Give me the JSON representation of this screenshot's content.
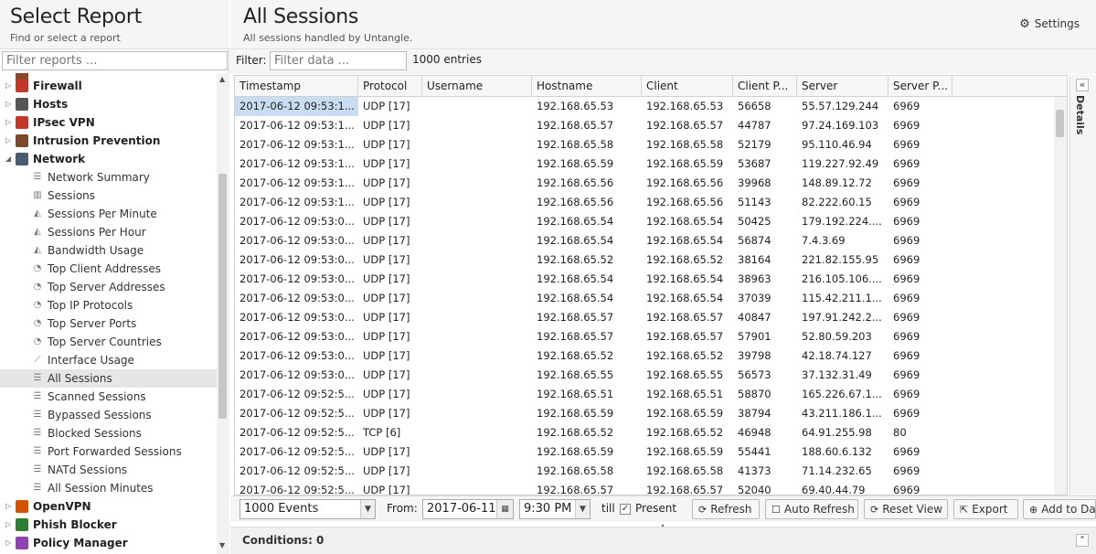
{
  "left": {
    "title": "Select Report",
    "subtitle": "Find or select a report",
    "filter_placeholder": "Filter reports ..."
  },
  "tree": [
    {
      "kind": "cat",
      "label": "Firewall",
      "color": "#c0392b",
      "expanded": false
    },
    {
      "kind": "cat",
      "label": "Hosts",
      "color": "#555555",
      "expanded": false
    },
    {
      "kind": "cat",
      "label": "IPsec VPN",
      "color": "#c0392b",
      "expanded": false
    },
    {
      "kind": "cat",
      "label": "Intrusion Prevention",
      "color": "#7a4a2a",
      "expanded": false
    },
    {
      "kind": "cat",
      "label": "Network",
      "color": "#4a5a70",
      "expanded": true
    },
    {
      "kind": "leaf",
      "label": "Network Summary",
      "icon": "list"
    },
    {
      "kind": "leaf",
      "label": "Sessions",
      "icon": "bar"
    },
    {
      "kind": "leaf",
      "label": "Sessions Per Minute",
      "icon": "area"
    },
    {
      "kind": "leaf",
      "label": "Sessions Per Hour",
      "icon": "area"
    },
    {
      "kind": "leaf",
      "label": "Bandwidth Usage",
      "icon": "area"
    },
    {
      "kind": "leaf",
      "label": "Top Client Addresses",
      "icon": "pie"
    },
    {
      "kind": "leaf",
      "label": "Top Server Addresses",
      "icon": "pie"
    },
    {
      "kind": "leaf",
      "label": "Top IP Protocols",
      "icon": "pie"
    },
    {
      "kind": "leaf",
      "label": "Top Server Ports",
      "icon": "pie"
    },
    {
      "kind": "leaf",
      "label": "Top Server Countries",
      "icon": "pie"
    },
    {
      "kind": "leaf",
      "label": "Interface Usage",
      "icon": "line"
    },
    {
      "kind": "leaf",
      "label": "All Sessions",
      "icon": "list",
      "selected": true
    },
    {
      "kind": "leaf",
      "label": "Scanned Sessions",
      "icon": "list"
    },
    {
      "kind": "leaf",
      "label": "Bypassed Sessions",
      "icon": "list"
    },
    {
      "kind": "leaf",
      "label": "Blocked Sessions",
      "icon": "list"
    },
    {
      "kind": "leaf",
      "label": "Port Forwarded Sessions",
      "icon": "list"
    },
    {
      "kind": "leaf",
      "label": "NATd Sessions",
      "icon": "list"
    },
    {
      "kind": "leaf",
      "label": "All Session Minutes",
      "icon": "list"
    },
    {
      "kind": "cat",
      "label": "OpenVPN",
      "color": "#d35400",
      "expanded": false
    },
    {
      "kind": "cat",
      "label": "Phish Blocker",
      "color": "#2e7d32",
      "expanded": false
    },
    {
      "kind": "cat",
      "label": "Policy Manager",
      "color": "#8e44ad",
      "expanded": false
    }
  ],
  "main": {
    "title": "All Sessions",
    "subtitle": "All sessions handled by Untangle.",
    "settings_label": "Settings",
    "filter_label": "Filter:",
    "filter_placeholder": "Filter data ...",
    "entries": "1000 entries",
    "details_label": "Details"
  },
  "columns": [
    "Timestamp",
    "Protocol",
    "Username",
    "Hostname",
    "Client",
    "Client P...",
    "Server",
    "Server P..."
  ],
  "rows": [
    [
      "2017-06-12 09:53:1...",
      "UDP [17]",
      "",
      "192.168.65.53",
      "192.168.65.53",
      "56658",
      "55.57.129.244",
      "6969"
    ],
    [
      "2017-06-12 09:53:1...",
      "UDP [17]",
      "",
      "192.168.65.57",
      "192.168.65.57",
      "44787",
      "97.24.169.103",
      "6969"
    ],
    [
      "2017-06-12 09:53:1...",
      "UDP [17]",
      "",
      "192.168.65.58",
      "192.168.65.58",
      "52179",
      "95.110.46.94",
      "6969"
    ],
    [
      "2017-06-12 09:53:1...",
      "UDP [17]",
      "",
      "192.168.65.59",
      "192.168.65.59",
      "53687",
      "119.227.92.49",
      "6969"
    ],
    [
      "2017-06-12 09:53:1...",
      "UDP [17]",
      "",
      "192.168.65.56",
      "192.168.65.56",
      "39968",
      "148.89.12.72",
      "6969"
    ],
    [
      "2017-06-12 09:53:1...",
      "UDP [17]",
      "",
      "192.168.65.56",
      "192.168.65.56",
      "51143",
      "82.222.60.15",
      "6969"
    ],
    [
      "2017-06-12 09:53:0...",
      "UDP [17]",
      "",
      "192.168.65.54",
      "192.168.65.54",
      "50425",
      "179.192.224....",
      "6969"
    ],
    [
      "2017-06-12 09:53:0...",
      "UDP [17]",
      "",
      "192.168.65.54",
      "192.168.65.54",
      "56874",
      "7.4.3.69",
      "6969"
    ],
    [
      "2017-06-12 09:53:0...",
      "UDP [17]",
      "",
      "192.168.65.52",
      "192.168.65.52",
      "38164",
      "221.82.155.95",
      "6969"
    ],
    [
      "2017-06-12 09:53:0...",
      "UDP [17]",
      "",
      "192.168.65.54",
      "192.168.65.54",
      "38963",
      "216.105.106....",
      "6969"
    ],
    [
      "2017-06-12 09:53:0...",
      "UDP [17]",
      "",
      "192.168.65.54",
      "192.168.65.54",
      "37039",
      "115.42.211.1...",
      "6969"
    ],
    [
      "2017-06-12 09:53:0...",
      "UDP [17]",
      "",
      "192.168.65.57",
      "192.168.65.57",
      "40847",
      "197.91.242.2...",
      "6969"
    ],
    [
      "2017-06-12 09:53:0...",
      "UDP [17]",
      "",
      "192.168.65.57",
      "192.168.65.57",
      "57901",
      "52.80.59.203",
      "6969"
    ],
    [
      "2017-06-12 09:53:0...",
      "UDP [17]",
      "",
      "192.168.65.52",
      "192.168.65.52",
      "39798",
      "42.18.74.127",
      "6969"
    ],
    [
      "2017-06-12 09:53:0...",
      "UDP [17]",
      "",
      "192.168.65.55",
      "192.168.65.55",
      "56573",
      "37.132.31.49",
      "6969"
    ],
    [
      "2017-06-12 09:52:5...",
      "UDP [17]",
      "",
      "192.168.65.51",
      "192.168.65.51",
      "58870",
      "165.226.67.1...",
      "6969"
    ],
    [
      "2017-06-12 09:52:5...",
      "UDP [17]",
      "",
      "192.168.65.59",
      "192.168.65.59",
      "38794",
      "43.211.186.1...",
      "6969"
    ],
    [
      "2017-06-12 09:52:5...",
      "TCP [6]",
      "",
      "192.168.65.52",
      "192.168.65.52",
      "46948",
      "64.91.255.98",
      "80"
    ],
    [
      "2017-06-12 09:52:5...",
      "UDP [17]",
      "",
      "192.168.65.59",
      "192.168.65.59",
      "55441",
      "188.60.6.132",
      "6969"
    ],
    [
      "2017-06-12 09:52:5...",
      "UDP [17]",
      "",
      "192.168.65.58",
      "192.168.65.58",
      "41373",
      "71.14.232.65",
      "6969"
    ],
    [
      "2017-06-12 09:52:5...",
      "UDP [17]",
      "",
      "192.168.65.57",
      "192.168.65.57",
      "52040",
      "69.40.44.79",
      "6969"
    ]
  ],
  "toolbar": {
    "events_value": "1000 Events",
    "from_label": "From:",
    "from_date": "2017-06-11",
    "from_time": "9:30 PM",
    "till_label": "till",
    "present_label": "Present",
    "present_checked": true,
    "refresh_label": "Refresh",
    "auto_refresh_label": "Auto Refresh",
    "reset_view_label": "Reset View",
    "export_label": "Export",
    "add_to_dashboard_label": "Add to Da"
  },
  "conditions_label": "Conditions: 0"
}
